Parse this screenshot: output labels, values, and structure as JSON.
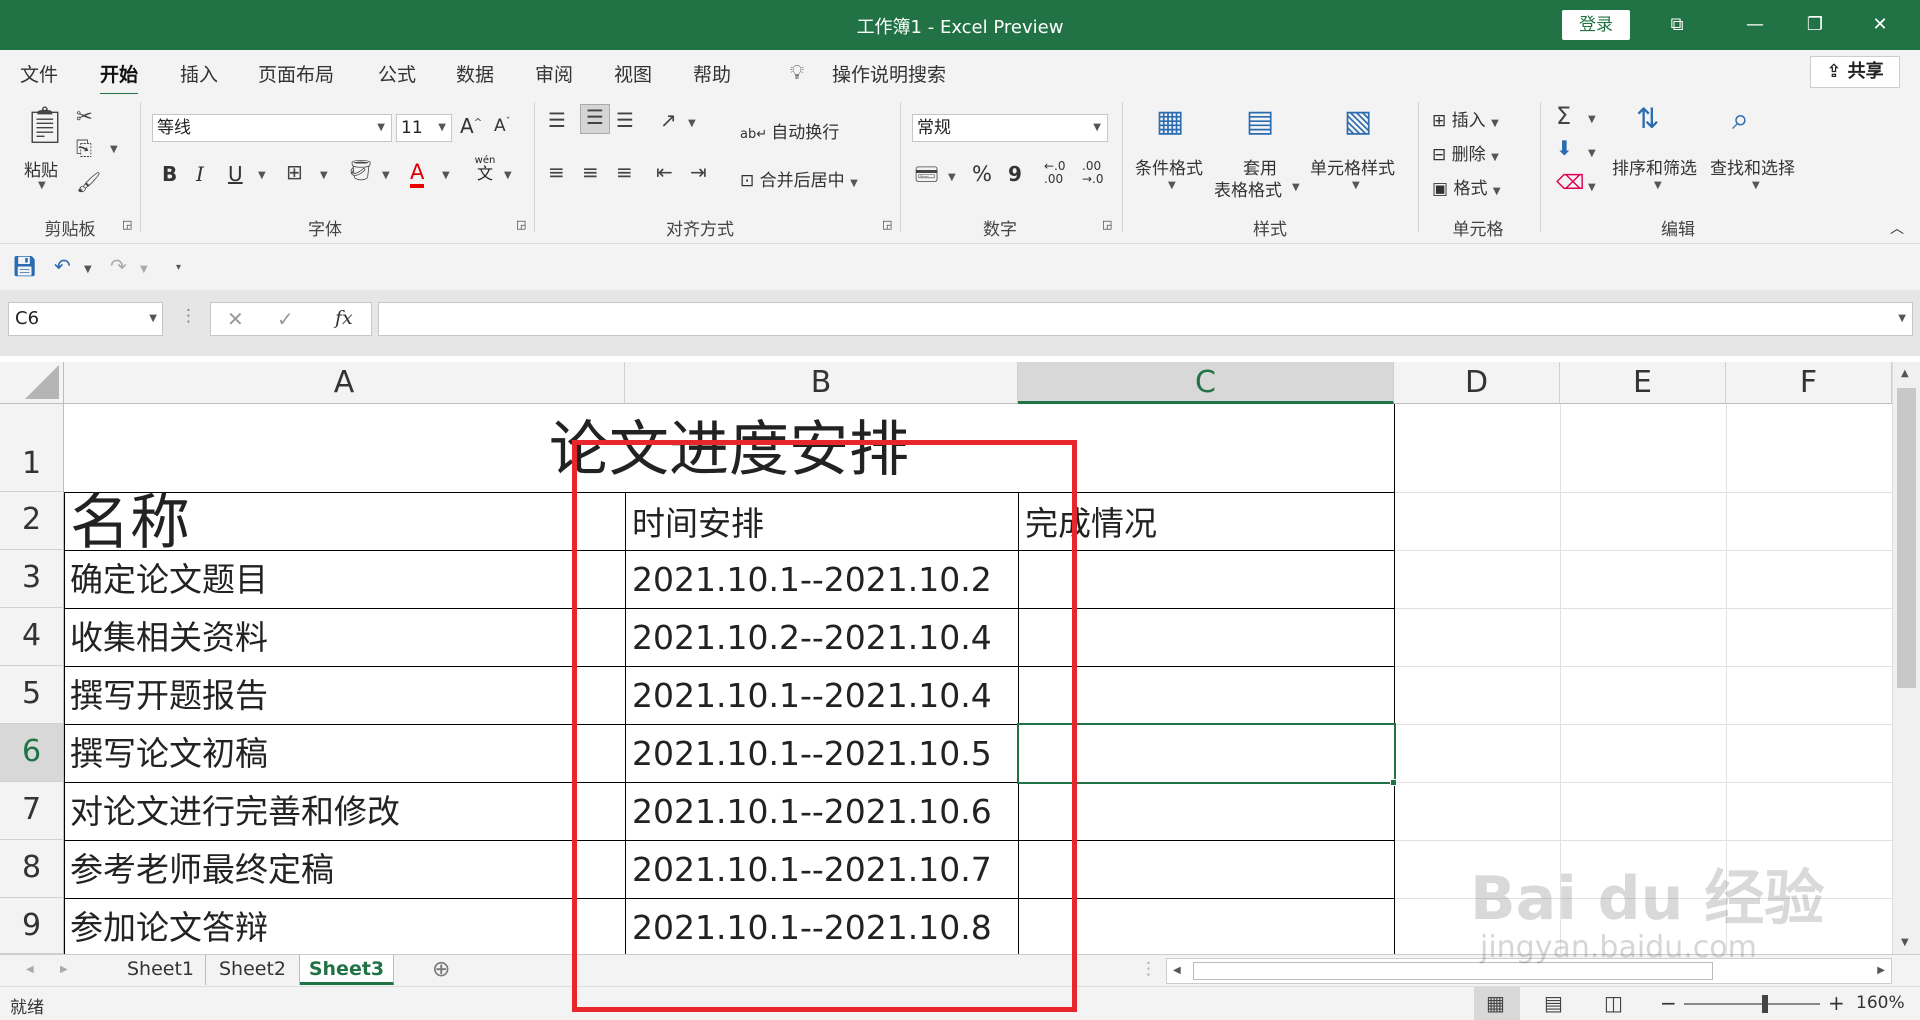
{
  "window": {
    "title": "工作簿1  -  Excel Preview",
    "login_label": "登录"
  },
  "menu": {
    "items": [
      "文件",
      "开始",
      "插入",
      "页面布局",
      "公式",
      "数据",
      "审阅",
      "视图",
      "帮助"
    ],
    "active": "开始",
    "search_label": "操作说明搜索",
    "share_label": "共享"
  },
  "ribbon": {
    "clipboard": {
      "paste": "粘贴",
      "group": "剪贴板"
    },
    "font": {
      "name": "等线",
      "size": "11",
      "group": "字体",
      "bold": "B",
      "italic": "I",
      "underline": "U",
      "grow": "A",
      "shrink": "A",
      "font_color": "A",
      "phonetic_top": "wén",
      "phonetic_bottom": "文"
    },
    "alignment": {
      "wrap": "自动换行",
      "merge": "合并后居中",
      "group": "对齐方式"
    },
    "number": {
      "format": "常规",
      "group": "数字",
      "percent": "%",
      "comma": "9",
      "inc_decimal": "←.0\n.00",
      "dec_decimal": ".00\n→.0"
    },
    "styles": {
      "conditional": "条件格式",
      "table_line1": "套用",
      "table_line2": "表格格式",
      "cell_styles": "单元格样式",
      "group": "样式"
    },
    "cells": {
      "insert": "插入",
      "delete": "删除",
      "format": "格式",
      "group": "单元格"
    },
    "editing": {
      "sort": "排序和筛选",
      "find": "查找和选择",
      "group": "编辑"
    }
  },
  "formula_bar": {
    "name_box": "C6",
    "fx": "fx",
    "formula": ""
  },
  "columns": [
    "A",
    "B",
    "C",
    "D",
    "E",
    "F"
  ],
  "selected_column": "C",
  "rows": [
    "1",
    "2",
    "3",
    "4",
    "5",
    "6",
    "7",
    "8",
    "9"
  ],
  "selected_row": "6",
  "sheet": {
    "title": "论文进度安排",
    "headers": {
      "a": "名称",
      "b": "时间安排",
      "c": "完成情况"
    },
    "data": [
      {
        "name": "确定论文题目",
        "time": "2021.10.1--2021.10.2",
        "status": ""
      },
      {
        "name": "收集相关资料",
        "time": "2021.10.2--2021.10.4",
        "status": ""
      },
      {
        "name": "撰写开题报告",
        "time": "2021.10.1--2021.10.4",
        "status": ""
      },
      {
        "name": "撰写论文初稿",
        "time": "2021.10.1--2021.10.5",
        "status": ""
      },
      {
        "name": "对论文进行完善和修改",
        "time": "2021.10.1--2021.10.6",
        "status": ""
      },
      {
        "name": "参考老师最终定稿",
        "time": "2021.10.1--2021.10.7",
        "status": ""
      },
      {
        "name": "参加论文答辩",
        "time": "2021.10.1--2021.10.8",
        "status": ""
      }
    ]
  },
  "tabs": [
    "Sheet1",
    "Sheet2",
    "Sheet3"
  ],
  "active_tab": "Sheet3",
  "status_bar": {
    "ready": "就绪",
    "zoom": "160%"
  },
  "watermark": {
    "brand": "Bai du 经验",
    "url": "jingyan.baidu.com"
  },
  "colors": {
    "excel_green": "#217346",
    "annotation_red": "#e8262b"
  }
}
